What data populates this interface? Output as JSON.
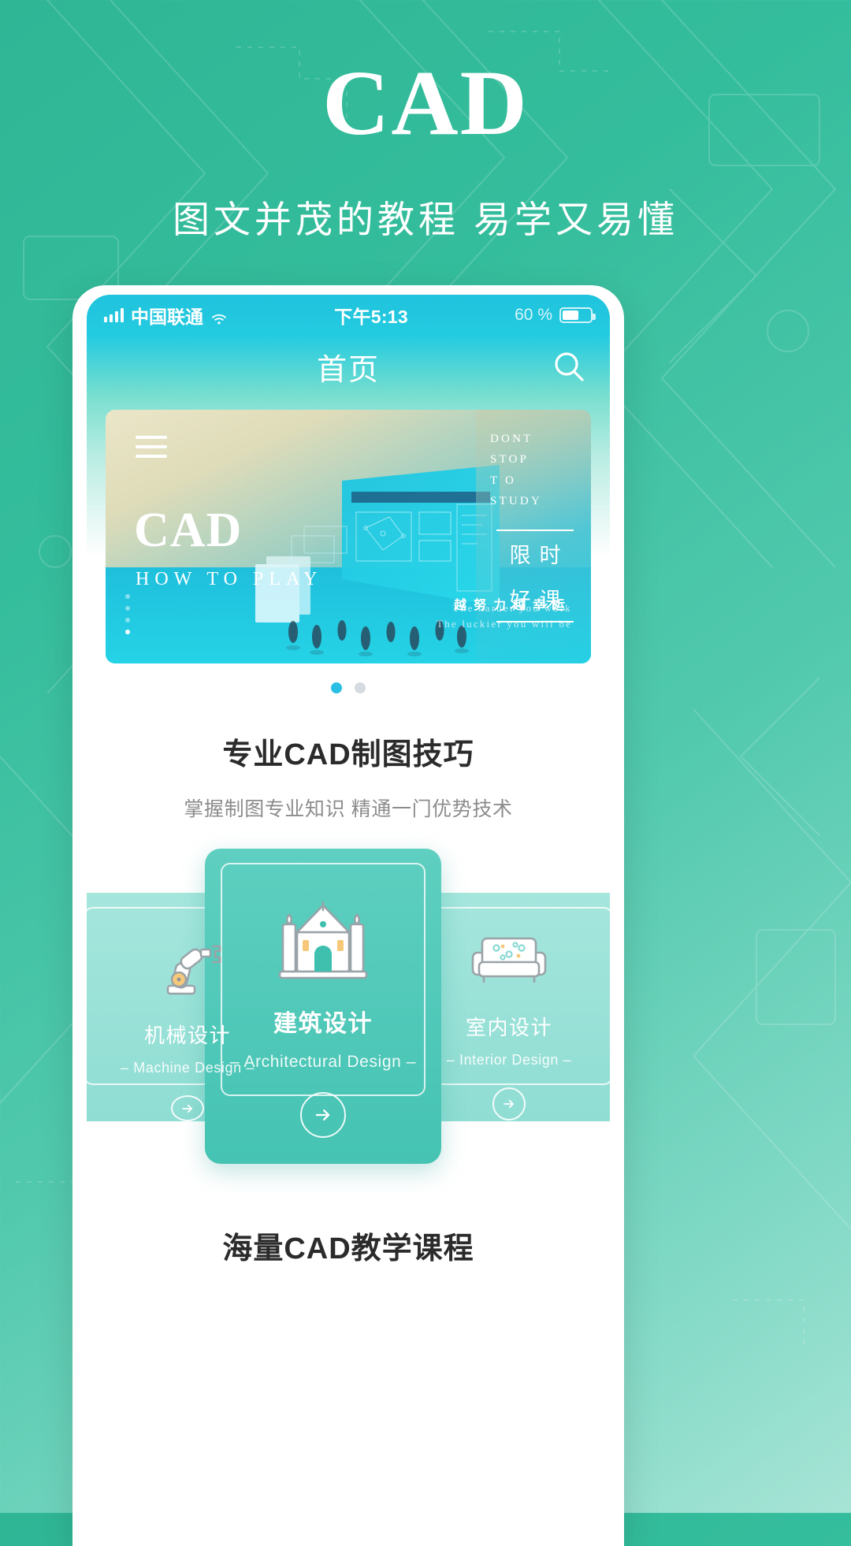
{
  "promo": {
    "title": "CAD",
    "subtitle": "图文并茂的教程 易学又易懂"
  },
  "phone": {
    "status_bar": {
      "carrier": "中国联通",
      "time": "下午5:13",
      "battery_text": "60 %",
      "battery_level": 60,
      "signal_icon": "signal-bars-icon",
      "wifi_icon": "wifi-icon",
      "battery_icon": "battery-icon"
    },
    "nav": {
      "title": "首页",
      "search_icon": "search-icon"
    },
    "banner": {
      "menu_icon": "hamburger-menu-icon",
      "headline": "CAD",
      "subhead": "HOW TO PLAY",
      "side_lines": [
        "DONT",
        "STOP",
        "T O",
        "STUDY"
      ],
      "badge_line1": "限时",
      "badge_line2": "好课",
      "slogan_cn": "越努力越幸运",
      "slogan_en_1": "The harder you work",
      "slogan_en_2": "The luckier you will be",
      "vertical_dots": 4,
      "vertical_active_index": 3
    },
    "carousel": {
      "dots": 2,
      "active_index": 0
    },
    "section1": {
      "title": "专业CAD制图技巧",
      "subtitle": "掌握制图专业知识  精通一门优势技术"
    },
    "cards": [
      {
        "name": "机械设计",
        "en": "– Machine Design –",
        "icon": "robot-arm-icon",
        "arrow_icon": "arrow-right-circle-icon"
      },
      {
        "name": "建筑设计",
        "en": "– Architectural Design –",
        "icon": "building-icon",
        "arrow_icon": "arrow-right-circle-icon"
      },
      {
        "name": "室内设计",
        "en": "– Interior Design –",
        "icon": "sofa-icon",
        "arrow_icon": "arrow-right-circle-icon"
      }
    ],
    "section2": {
      "title": "海量CAD教学课程"
    }
  },
  "colors": {
    "brand_green": "#34bd9c",
    "brand_cyan": "#23cbe0",
    "accent_dot": "#29bfe3",
    "card_center": "#45c3b3",
    "card_side": "#8fddd3"
  }
}
